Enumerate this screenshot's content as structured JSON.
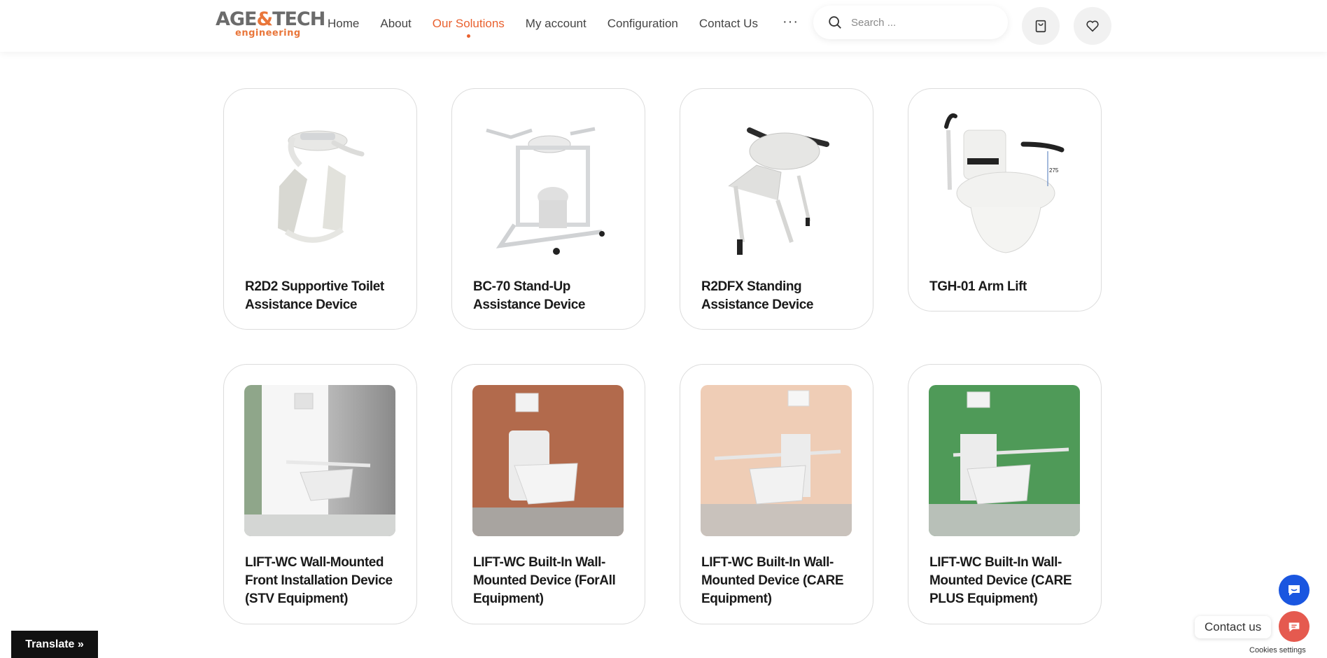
{
  "logo": {
    "main_left": "AGE",
    "main_amp": "&",
    "main_right": "TECH",
    "sub": "engineering"
  },
  "nav": {
    "items": [
      {
        "label": "Home"
      },
      {
        "label": "About"
      },
      {
        "label": "Our Solutions",
        "active": true
      },
      {
        "label": "My account"
      },
      {
        "label": "Configuration"
      },
      {
        "label": "Contact Us"
      }
    ],
    "more_label": "···"
  },
  "search": {
    "placeholder": "Search ..."
  },
  "products": [
    {
      "title": "R2D2 Supportive Toilet Assistance Device",
      "icon": "supportive-toilet-device-image"
    },
    {
      "title": "BC-70 Stand-Up Assistance Device",
      "icon": "stand-up-device-image"
    },
    {
      "title": "R2DFX Standing Assistance Device",
      "icon": "standing-device-image"
    },
    {
      "title": "TGH-01 Arm Lift",
      "icon": "arm-lift-image",
      "dimension": "275"
    },
    {
      "title": "LIFT-WC Wall-Mounted Front Installation Device (STV Equipment)",
      "icon": "wall-mounted-wc-image"
    },
    {
      "title": "LIFT-WC Built-In Wall-Mounted Device (ForAll Equipment)",
      "icon": "wall-mounted-wc-image"
    },
    {
      "title": "LIFT-WC Built-In Wall-Mounted Device (CARE Equipment)",
      "icon": "wall-mounted-wc-image"
    },
    {
      "title": "LIFT-WC Built-In Wall-Mounted Device (CARE PLUS Equipment)",
      "icon": "wall-mounted-wc-image"
    }
  ],
  "colors": {
    "accent": "#e9612f",
    "chat": "#1a56e0",
    "contact": "#e55a4f"
  },
  "widgets": {
    "translate_label": "Translate »",
    "contact_label": "Contact us",
    "cookies_label": "Cookies settings"
  }
}
